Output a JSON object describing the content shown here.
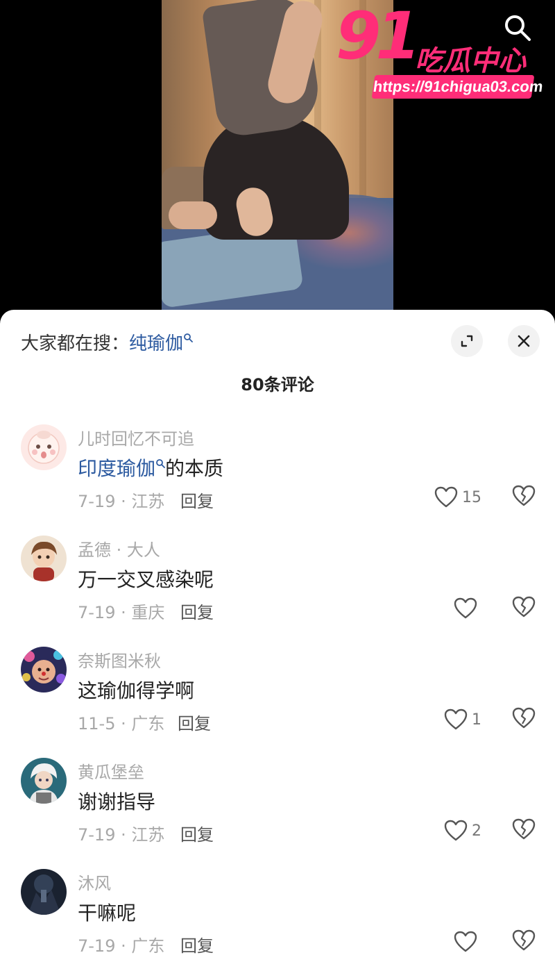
{
  "watermark": {
    "number": "91",
    "brand": "吃瓜中心",
    "url": "https://91chigua03.com"
  },
  "search_hint": {
    "prefix": "大家都在搜：",
    "keyword": "纯瑜伽"
  },
  "comment_count": "80条评论",
  "reply_label": "回复",
  "comments": [
    {
      "user": "儿时回忆不可追",
      "text_link": "印度瑜伽",
      "text": "的本质",
      "meta": "7-19 · 江苏",
      "likes": "15"
    },
    {
      "user": "孟德 · 大人",
      "text_link": "",
      "text": "万一交叉感染呢",
      "meta": "7-19 · 重庆",
      "likes": ""
    },
    {
      "user": "奈斯图米秋",
      "text_link": "",
      "text": "这瑜伽得学啊",
      "meta": "11-5 · 广东",
      "likes": "1"
    },
    {
      "user": "黄瓜堡垒",
      "text_link": "",
      "text": "谢谢指导",
      "meta": "7-19 · 江苏",
      "likes": "2"
    },
    {
      "user": "沐风",
      "text_link": "",
      "text": "干嘛呢",
      "meta": "7-19 · 广东",
      "likes": ""
    }
  ],
  "colors": {
    "accent_link": "#2c5aa0",
    "watermark_pink": "#ff2d78"
  },
  "icons": [
    "search-icon",
    "expand-icon",
    "close-icon",
    "heart-icon",
    "broken-heart-icon"
  ]
}
